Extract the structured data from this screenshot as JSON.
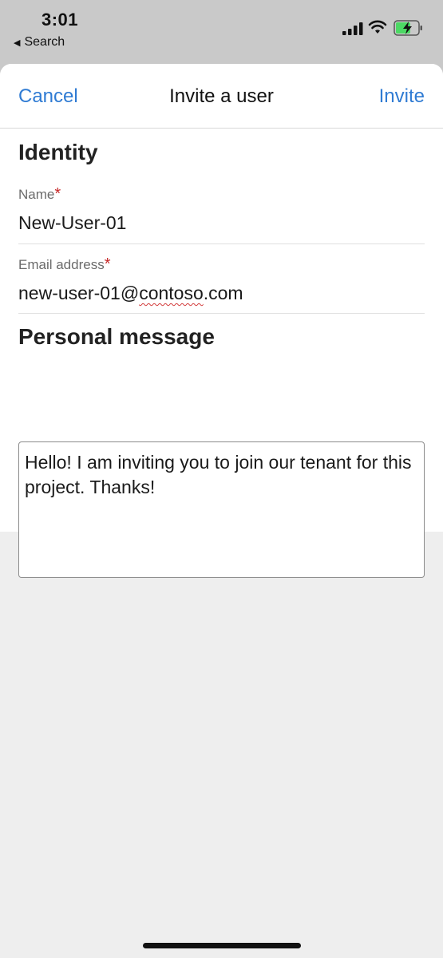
{
  "status_bar": {
    "time": "3:01",
    "back_app": "Search",
    "icons": [
      "cellular-signal-icon",
      "wifi-icon",
      "battery-charging-icon"
    ],
    "battery_color": "#4cd964"
  },
  "nav": {
    "cancel_label": "Cancel",
    "title": "Invite a user",
    "invite_label": "Invite"
  },
  "identity": {
    "heading": "Identity",
    "name_label": "Name",
    "name_value": "New-User-01",
    "email_label": "Email address",
    "email_value_prefix": "new-user-01@",
    "email_value_misspelled": "contoso",
    "email_value_suffix": ".com",
    "required_marker": "*"
  },
  "message": {
    "heading": "Personal message",
    "text": "Hello! I am inviting you to join our tenant for this project. Thanks!"
  },
  "colors": {
    "accent": "#2f7bd3",
    "required": "#c62828"
  }
}
